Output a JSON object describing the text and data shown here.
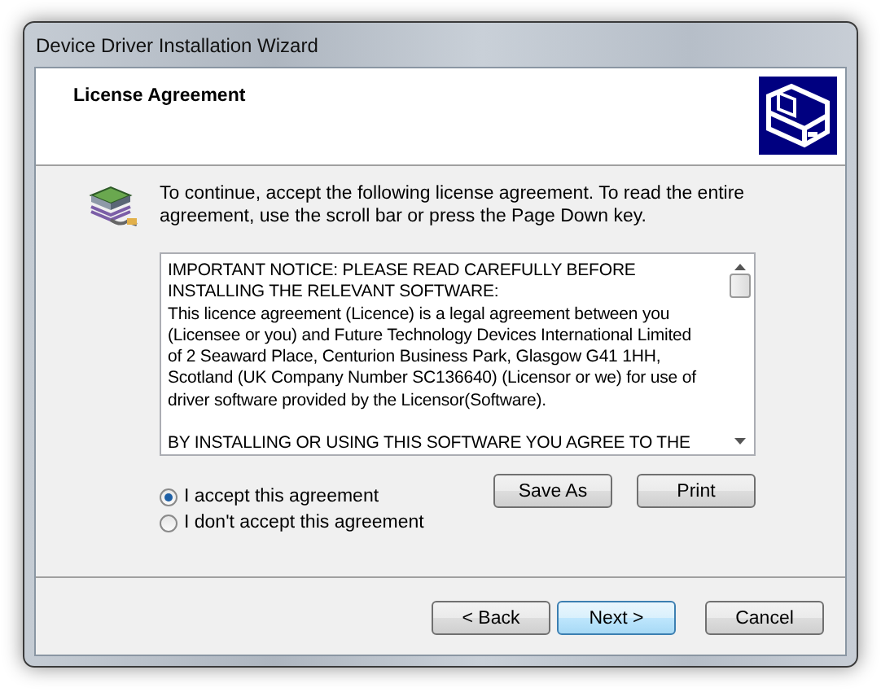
{
  "window": {
    "title": "Device Driver Installation Wizard"
  },
  "header": {
    "title": "License Agreement"
  },
  "instructions": "To continue, accept the following license agreement. To read the entire agreement, use the scroll bar or press the Page Down key.",
  "license_paragraphs": [
    [
      "IMPORTANT NOTICE: PLEASE READ CAREFULLY BEFORE",
      "INSTALLING THE RELEVANT SOFTWARE:",
      "This licence agreement (Licence) is a legal agreement between you",
      "(Licensee or you) and Future Technology Devices International Limited",
      "of 2 Seaward Place, Centurion Business Park, Glasgow G41 1HH,",
      "Scotland (UK Company Number SC136640) (Licensor or we) for use of",
      "driver software provided by the Licensor(Software)."
    ],
    [
      "BY INSTALLING OR USING THIS SOFTWARE YOU AGREE TO THE"
    ]
  ],
  "options": [
    {
      "label": "I accept this agreement",
      "selected": true
    },
    {
      "label": "I don't accept this agreement",
      "selected": false
    }
  ],
  "side_buttons": [
    "Save As",
    "Print"
  ],
  "nav_buttons": [
    {
      "label": "< Back",
      "default": false
    },
    {
      "label": "Next >",
      "default": true
    },
    {
      "label": "Cancel",
      "default": false
    }
  ]
}
